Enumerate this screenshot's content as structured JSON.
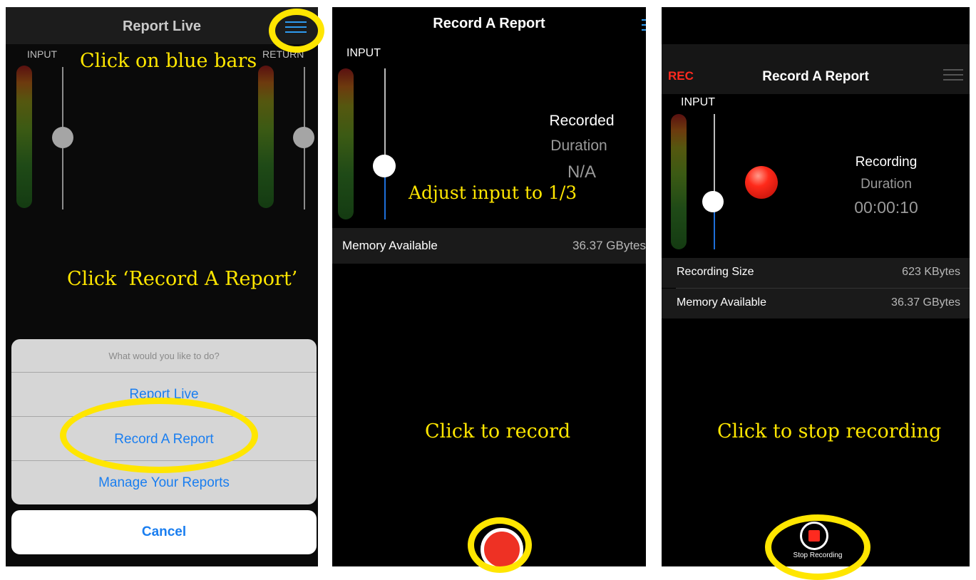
{
  "panel1": {
    "title": "Report Live",
    "input_label": "INPUT",
    "return_label": "RETURN",
    "annotation_bars": "Click on blue bars",
    "annotation_record": "Click ‘Record A Report’",
    "sheet": {
      "title": "What would you like to do?",
      "items": [
        "Report Live",
        "Record A Report",
        "Manage Your Reports"
      ],
      "cancel": "Cancel"
    }
  },
  "panel2": {
    "title": "Record A Report",
    "input_label": "INPUT",
    "status": "Recorded",
    "duration_label": "Duration",
    "duration_value": "N/A",
    "annotation_adjust": "Adjust input to 1/3",
    "memory_label": "Memory Available",
    "memory_value": "36.37 GBytes",
    "annotation_record": "Click to record"
  },
  "panel3": {
    "rec_badge": "REC",
    "title": "Record A Report",
    "input_label": "INPUT",
    "status": "Recording",
    "duration_label": "Duration",
    "duration_value": "00:00:10",
    "recording_size_label": "Recording Size",
    "recording_size_value": "623 KBytes",
    "memory_label": "Memory Available",
    "memory_value": "36.37 GBytes",
    "annotation_stop": "Click to stop recording",
    "stop_label": "Stop Recording"
  },
  "colors": {
    "annotation_yellow": "#ffe600",
    "ios_blue": "#1a7ef0",
    "record_red": "#ee3124",
    "rec_badge_red": "#ff2a1f"
  },
  "icons": [
    "hamburger-menu-icon",
    "record-button-icon",
    "recording-indicator-icon",
    "stop-icon"
  ],
  "levels": {
    "panel1_input_gain": 0.5,
    "panel1_return_gain": 0.5,
    "panel2_input_gain": 0.33,
    "panel3_input_gain": 0.33
  }
}
